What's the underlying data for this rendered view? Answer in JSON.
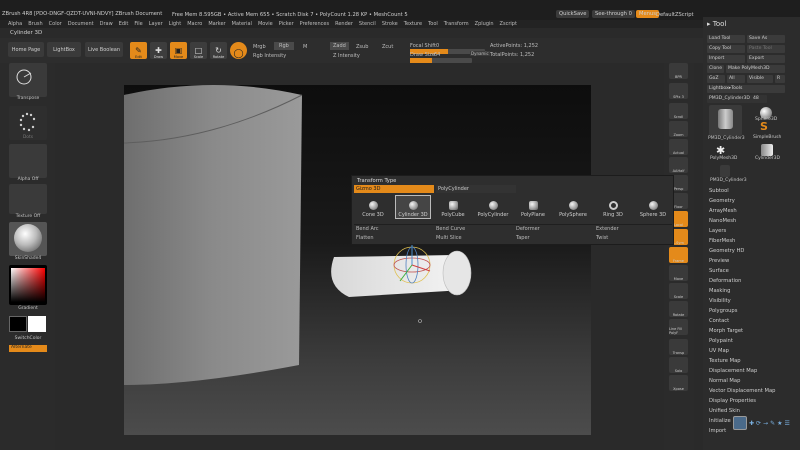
{
  "titlebar": {
    "app_title": "ZBrush 4R8 [PDO-DNGF-QZDT-UVNI-NDVY]   ZBrush Document",
    "stats": "Free Mem 8.595GB • Active Mem 655 • Scratch Disk 7 • PolyCount 1.28 KP • MeshCount 5",
    "quicksave": "QuickSave",
    "seethrough": "See-through  0",
    "menus_btn": "Menus",
    "script": "DefaultZScript"
  },
  "menubar": [
    "Alpha",
    "Brush",
    "Color",
    "Document",
    "Draw",
    "Edit",
    "File",
    "Layer",
    "Light",
    "Macro",
    "Marker",
    "Material",
    "Movie",
    "Picker",
    "Preferences",
    "Render",
    "Stencil",
    "Stroke",
    "Texture",
    "Tool",
    "Transform",
    "Zplugin",
    "Zscript"
  ],
  "subtitle": "Cylinder 3D",
  "toolbar": {
    "home_page": "Home Page",
    "lightbox": "LightBox",
    "live_boolean": "Live Boolean",
    "edit": "Edit",
    "draw": "Draw",
    "move": "Move",
    "scale": "Scale",
    "rotate": "Rotate",
    "mrgb": "Mrgb",
    "rgb": "Rgb",
    "m": "M",
    "rgb_intensity": "Rgb Intensity",
    "zadd": "Zadd",
    "zsub": "Zsub",
    "zcut": "Zcut",
    "z_intensity": "Z Intensity",
    "focal_shift_label": "Focal Shift",
    "focal_shift_value": "0",
    "draw_size_label": "Draw Size",
    "draw_size_value": "64",
    "dynamic": "Dynamic",
    "active_points": "ActivePoints: 1,252",
    "total_points": "TotalPoints: 1,252",
    "draw_size_fill": 0.35,
    "focal_fill": 0.5
  },
  "left_shelf": {
    "transpose": "Transpose",
    "dots": "Dots",
    "alpha_off": "Alpha Off",
    "texture_off": "Texture Off",
    "skinshade": "SkinShade4",
    "gradient": "Gradient",
    "switchcolor": "SwitchColor",
    "alternate": "Alternate"
  },
  "right_shelf": [
    "BPR",
    "SPix 3",
    "Scroll",
    "Zoom",
    "Actual",
    "AAHalf",
    "Persp",
    "Floor",
    "Local",
    "L.Sym",
    "Frame",
    "Move",
    "Scale",
    "Rotate",
    "Line Fill PolyF",
    "Transp",
    "Solo",
    "Xpose"
  ],
  "tool_panel": {
    "title": "Tool",
    "load_tool": "Load Tool",
    "save_as": "Save As",
    "copy_tool": "Copy Tool",
    "paste_tool": "Paste Tool",
    "import": "Import",
    "export": "Export",
    "clone": "Clone",
    "make_polymesh": "Make PolyMesh3D",
    "goz": "GoZ",
    "all": "All",
    "visible": "Visible",
    "r": "R",
    "lightbox_tools": "Lightbox▸Tools",
    "current_tool": "PM3D_Cylinder3D",
    "current_count": "48",
    "thumbs": [
      "PM3D_Cylinder3",
      "Sphere3D",
      "PolyMesh3D",
      "SimpleBrush",
      "PM3D_Cylinder3",
      "Cylinder3D"
    ],
    "menu": [
      "Subtool",
      "Geometry",
      "ArrayMesh",
      "NanoMesh",
      "Layers",
      "FiberMesh",
      "Geometry HD",
      "Preview",
      "Surface",
      "Deformation",
      "Masking",
      "Visibility",
      "Polygroups",
      "Contact",
      "Morph Target",
      "Polypaint",
      "UV Map",
      "Texture Map",
      "Displacement Map",
      "Normal Map",
      "Vector Displacement Map",
      "Display Properties",
      "Unified Skin",
      "Initialize",
      "Import"
    ]
  },
  "popup": {
    "header": "Transform Type",
    "tabs": [
      "Gizmo 3D",
      "PolyCylinder"
    ],
    "items": [
      "Cone 3D",
      "Cylinder 3D",
      "PolyCube",
      "PolyCylinder",
      "PolyPlane",
      "PolySphere",
      "Ring 3D",
      "Sphere 3D"
    ],
    "deformers": [
      "Bend Arc",
      "Bend Curve",
      "Deformer",
      "Extender",
      "Flatten",
      "Multi Slice",
      "Taper",
      "Twist"
    ]
  },
  "colors": {
    "accent": "#e48a1a",
    "panel": "#2c2c2c"
  }
}
